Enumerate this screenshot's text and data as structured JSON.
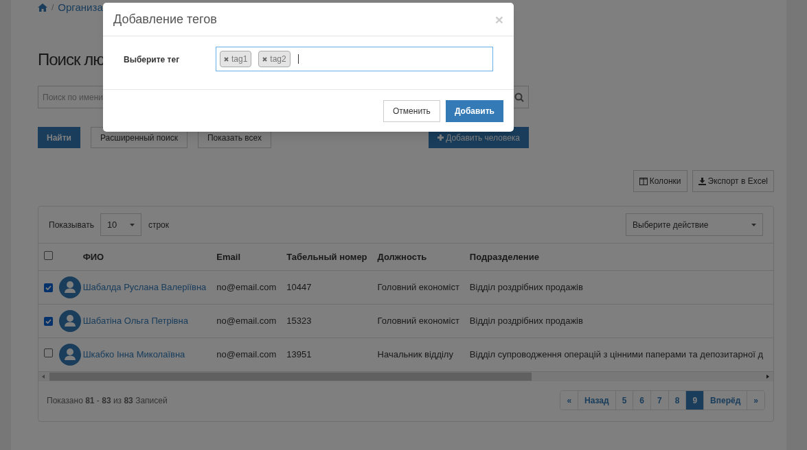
{
  "breadcrumb": {
    "separator": "/",
    "items": [
      "Организа"
    ]
  },
  "page_title": "Поиск лю",
  "search": {
    "placeholder": "Поиск по имени"
  },
  "actions": [
    {
      "label": "Найти",
      "kind": "primary"
    },
    {
      "label": "Расширенный поиск",
      "kind": "default"
    },
    {
      "label": "Показать всех",
      "kind": "default"
    },
    {
      "label": "Добавить человека",
      "kind": "add"
    }
  ],
  "toolbar": [
    {
      "label": "Колонки",
      "kind": "columns"
    },
    {
      "label": "Экспорт в Excel",
      "kind": "export"
    }
  ],
  "page_size": {
    "prefix": "Показывать",
    "value": "10",
    "suffix": "строк"
  },
  "bulk_action": {
    "placeholder": "Выберите действие"
  },
  "table": {
    "select_all": {
      "checked": false
    },
    "columns": [
      "ФИО",
      "Email",
      "Табельный номер",
      "Должность",
      "Подразделение"
    ],
    "rows": [
      {
        "checked": true,
        "cells": [
          "Шабалда Руслана Валеріївна",
          "no@email.com",
          "10447",
          "Головний економіст",
          "Відділ роздрібних продажів"
        ]
      },
      {
        "checked": true,
        "cells": [
          "Шабатіна Ольга Петрівна",
          "no@email.com",
          "15323",
          "Головний економіст",
          "Відділ роздрібних продажів"
        ]
      },
      {
        "checked": false,
        "cells": [
          "Шкабко Інна Миколаївна",
          "no@email.com",
          "13951",
          "Начальник відділу",
          "Відділ супроводження операцій з цінними паперами та депозитарної д"
        ]
      }
    ]
  },
  "summary": "Показано **81** - **83** из **83** Записей",
  "pagination": [
    {
      "label": "«",
      "selected": false
    },
    {
      "label": "Назад",
      "selected": false
    },
    {
      "label": "5",
      "selected": false
    },
    {
      "label": "6",
      "selected": false
    },
    {
      "label": "7",
      "selected": false
    },
    {
      "label": "8",
      "selected": false
    },
    {
      "label": "9",
      "selected": true
    },
    {
      "label": "Вперёд",
      "selected": false
    },
    {
      "label": "»",
      "selected": false
    }
  ],
  "modal": {
    "title": "Добавление тегов",
    "close": "×",
    "field_label": "Выберите тег",
    "tags": [
      {
        "label": "tag1"
      },
      {
        "label": "tag2"
      }
    ],
    "buttons": [
      {
        "label": "Отменить",
        "kind": "default"
      },
      {
        "label": "Добавить",
        "kind": "primary"
      }
    ]
  }
}
